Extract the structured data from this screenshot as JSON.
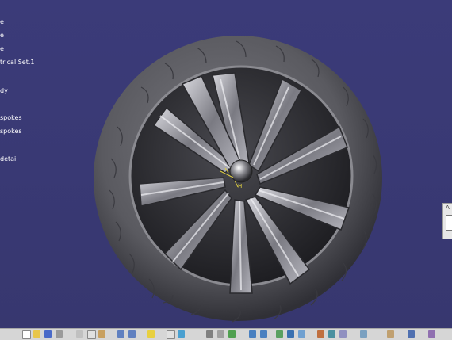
{
  "specification_tree": {
    "items": [
      {
        "label": "e"
      },
      {
        "label": "e"
      },
      {
        "label": "e"
      },
      {
        "label": "trical Set.1"
      },
      {
        "label": "dy"
      },
      {
        "label": "spokes"
      },
      {
        "label": "spokes"
      },
      {
        "label": "detail"
      }
    ]
  },
  "model": {
    "name": "wheel-with-spokes-and-tire",
    "rim_color": "#9a9aa0",
    "tire_color": "#5e5e62",
    "background_color": "#3a3a76"
  },
  "side_panel": {
    "title": "A"
  },
  "toolbar": {
    "icons": [
      "new-icon",
      "open-icon",
      "save-icon",
      "print-icon",
      "cut-icon",
      "copy-icon",
      "paste-icon",
      "undo-icon",
      "redo-icon",
      "help-icon",
      "select-icon",
      "fly-icon",
      "fit-all-icon",
      "pan-icon",
      "rotate-icon",
      "zoom-in-icon",
      "zoom-out-icon",
      "normal-view-icon",
      "multi-view-icon",
      "views-icon",
      "render-icon",
      "hide-show-icon",
      "swap-icon",
      "measure-icon",
      "apply-material-icon",
      "sketch-icon",
      "axis-icon"
    ]
  }
}
